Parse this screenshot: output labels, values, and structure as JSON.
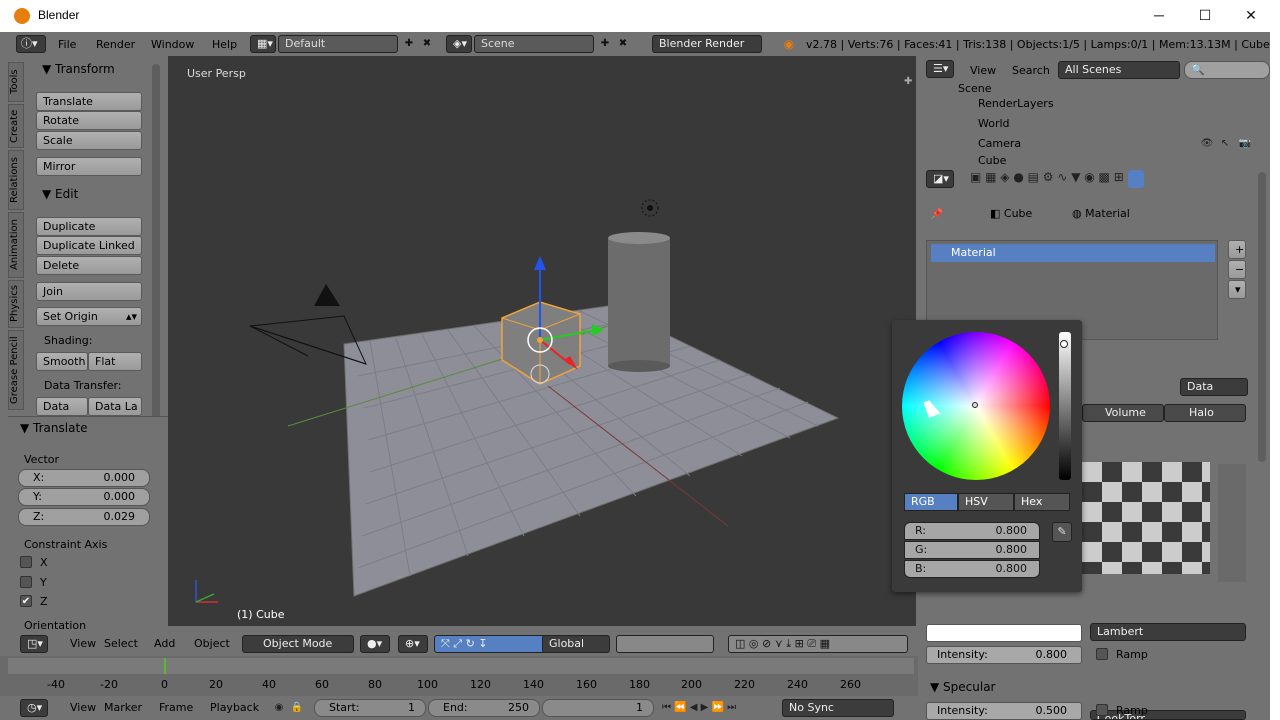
{
  "window": {
    "title": "Blender",
    "minimize": "─",
    "maximize": "☐",
    "close": "✕"
  },
  "topbar": {
    "menus": [
      "File",
      "Render",
      "Window",
      "Help"
    ],
    "layout": "Default",
    "scene": "Scene",
    "engine": "Blender Render",
    "stats": "v2.78 | Verts:76 | Faces:41 | Tris:138 | Objects:1/5 | Lamps:0/1 | Mem:13.13M | Cube"
  },
  "tool_tabs": [
    "Tools",
    "Create",
    "Relations",
    "Animation",
    "Physics",
    "Grease Pencil"
  ],
  "toolshelf": {
    "transform_header": "Transform",
    "translate": "Translate",
    "rotate": "Rotate",
    "scale": "Scale",
    "mirror": "Mirror",
    "edit_header": "Edit",
    "duplicate": "Duplicate",
    "duplicate_linked": "Duplicate Linked",
    "delete": "Delete",
    "join": "Join",
    "set_origin": "Set Origin",
    "shading_label": "Shading:",
    "smooth": "Smooth",
    "flat": "Flat",
    "data_transfer_label": "Data Transfer:",
    "data": "Data",
    "data_la": "Data La"
  },
  "operator": {
    "header": "Translate",
    "vector_label": "Vector",
    "x_label": "X:",
    "x_value": "0.000",
    "y_label": "Y:",
    "y_value": "0.000",
    "z_label": "Z:",
    "z_value": "0.029",
    "constraint_label": "Constraint Axis",
    "axis_x": "X",
    "axis_y": "Y",
    "axis_z": "Z",
    "axis_x_checked": false,
    "axis_y_checked": false,
    "axis_z_checked": true,
    "orientation_label": "Orientation"
  },
  "viewport": {
    "view_label": "User Persp",
    "object_label": "(1) Cube"
  },
  "viewport_header": {
    "view": "View",
    "select": "Select",
    "add": "Add",
    "object": "Object",
    "mode": "Object Mode",
    "orientation": "Global"
  },
  "timeline": {
    "ticks": [
      "-40",
      "-20",
      "0",
      "20",
      "40",
      "60",
      "80",
      "100",
      "120",
      "140",
      "160",
      "180",
      "200",
      "220",
      "240",
      "260"
    ],
    "view": "View",
    "marker": "Marker",
    "frame": "Frame",
    "playback": "Playback",
    "start_label": "Start:",
    "start_value": "1",
    "end_label": "End:",
    "end_value": "250",
    "current_frame": "1",
    "sync": "No Sync"
  },
  "outliner": {
    "view": "View",
    "search": "Search",
    "filter": "All Scenes",
    "items": [
      {
        "label": "Scene"
      },
      {
        "label": "RenderLayers"
      },
      {
        "label": "World"
      },
      {
        "label": "Camera"
      },
      {
        "label": "Cube"
      }
    ]
  },
  "properties": {
    "breadcrumb_object": "Cube",
    "breadcrumb_material": "Material",
    "material_slot": "Material",
    "data_dropdown": "Data",
    "volume_tab": "Volume",
    "halo_tab": "Halo",
    "diffuse_shader": "Lambert",
    "intensity_label": "Intensity:",
    "diffuse_intensity": "0.800",
    "ramp": "Ramp",
    "specular_header": "Specular",
    "specular_shader": "CookTorr",
    "specular_intensity": "0.500"
  },
  "color_picker": {
    "tabs": [
      "RGB",
      "HSV",
      "Hex"
    ],
    "active_tab": "RGB",
    "r_label": "R:",
    "r_value": "0.800",
    "g_label": "G:",
    "g_value": "0.800",
    "b_label": "B:",
    "b_value": "0.800"
  },
  "colors": {
    "panel": "#727272",
    "viewport_bg": "#393939",
    "selected_blue": "#5680c2",
    "orange": "#e87d0d"
  }
}
